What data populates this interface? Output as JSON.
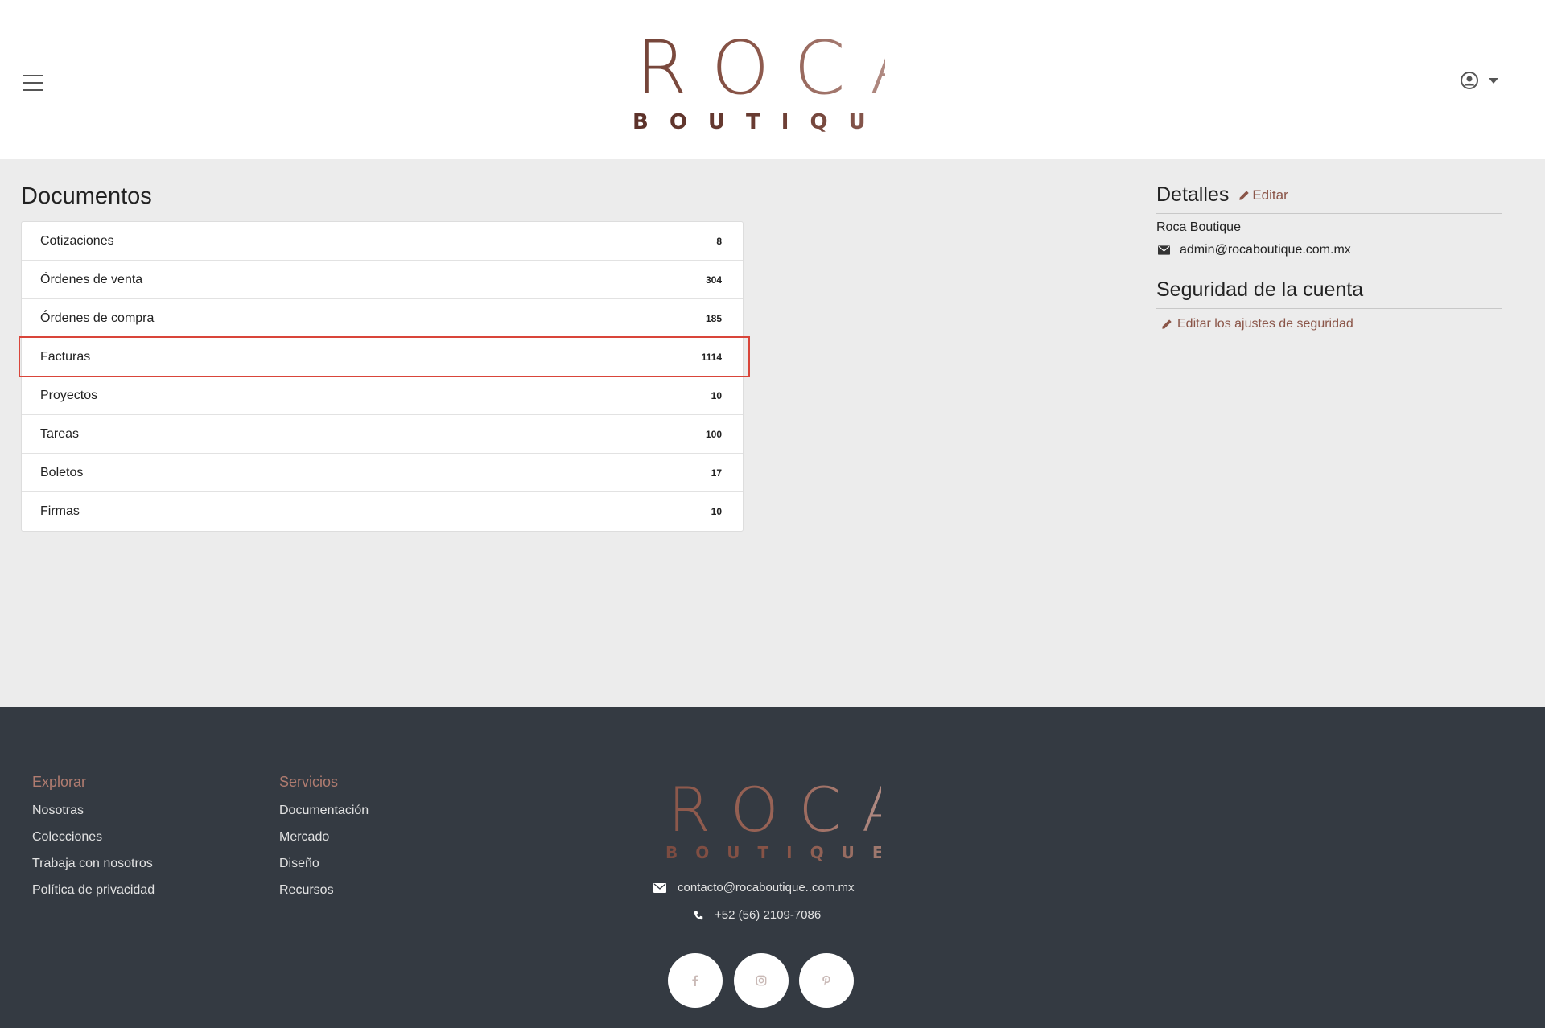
{
  "header": {
    "logo_main": "ROCA",
    "logo_sub": "BOUTIQUE"
  },
  "documents": {
    "title": "Documentos",
    "items": [
      {
        "label": "Cotizaciones",
        "count": "8"
      },
      {
        "label": "Órdenes de venta",
        "count": "304"
      },
      {
        "label": "Órdenes de compra",
        "count": "185"
      },
      {
        "label": "Facturas",
        "count": "1114"
      },
      {
        "label": "Proyectos",
        "count": "10"
      },
      {
        "label": "Tareas",
        "count": "100"
      },
      {
        "label": "Boletos",
        "count": "17"
      },
      {
        "label": "Firmas",
        "count": "10"
      }
    ]
  },
  "details": {
    "title": "Detalles",
    "edit_label": "Editar",
    "name": "Roca Boutique",
    "email": "admin@rocaboutique.com.mx"
  },
  "security": {
    "title": "Seguridad de la cuenta",
    "edit_label": "Editar los ajustes de seguridad"
  },
  "footer": {
    "explore": {
      "heading": "Explorar",
      "links": [
        "Nosotras",
        "Colecciones",
        "Trabaja con nosotros",
        "Política de privacidad"
      ]
    },
    "services": {
      "heading": "Servicios",
      "links": [
        "Documentación",
        "Mercado",
        "Diseño",
        "Recursos"
      ]
    },
    "logo_main": "ROCA",
    "logo_sub": "BOUTIQUE",
    "contact_email": "contacto@rocaboutique..com.mx",
    "contact_phone": "+52 (56) 2109-7086",
    "social": [
      "facebook-icon",
      "instagram-icon",
      "pinterest-icon"
    ]
  },
  "colors": {
    "accent": "#8a5548",
    "highlight_border": "#d9453a",
    "footer_bg": "#343a42",
    "page_bg": "#ececec"
  }
}
